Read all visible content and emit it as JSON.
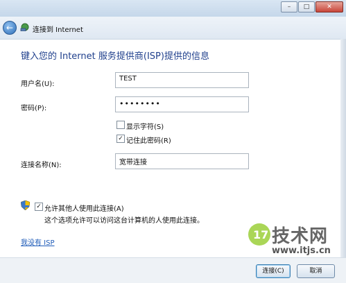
{
  "window": {
    "title": "连接到 Internet",
    "controls": {
      "minimize": "–",
      "maximize": "□",
      "close": "✕"
    }
  },
  "main": {
    "heading": "键入您的 Internet 服务提供商(ISP)提供的信息",
    "username": {
      "label": "用户名(U):",
      "value": "TEST"
    },
    "password": {
      "label": "密码(P):",
      "value": "••••••••"
    },
    "show_chars": {
      "label": "显示字符(S)",
      "checked": false
    },
    "remember": {
      "label": "记住此密码(R)",
      "checked": true
    },
    "connection_name": {
      "label": "连接名称(N):",
      "value": "宽带连接"
    },
    "allow_others": {
      "label": "允许其他人使用此连接(A)",
      "checked": true,
      "description": "这个选项允许可以访问这台计算机的人使用此连接。"
    },
    "no_isp_link": "我没有 ISP"
  },
  "footer": {
    "connect_label": "连接(C)",
    "cancel_label": "取消"
  },
  "watermark": {
    "text": "技术网",
    "url": "www.itjs.cn",
    "mark": "17"
  }
}
